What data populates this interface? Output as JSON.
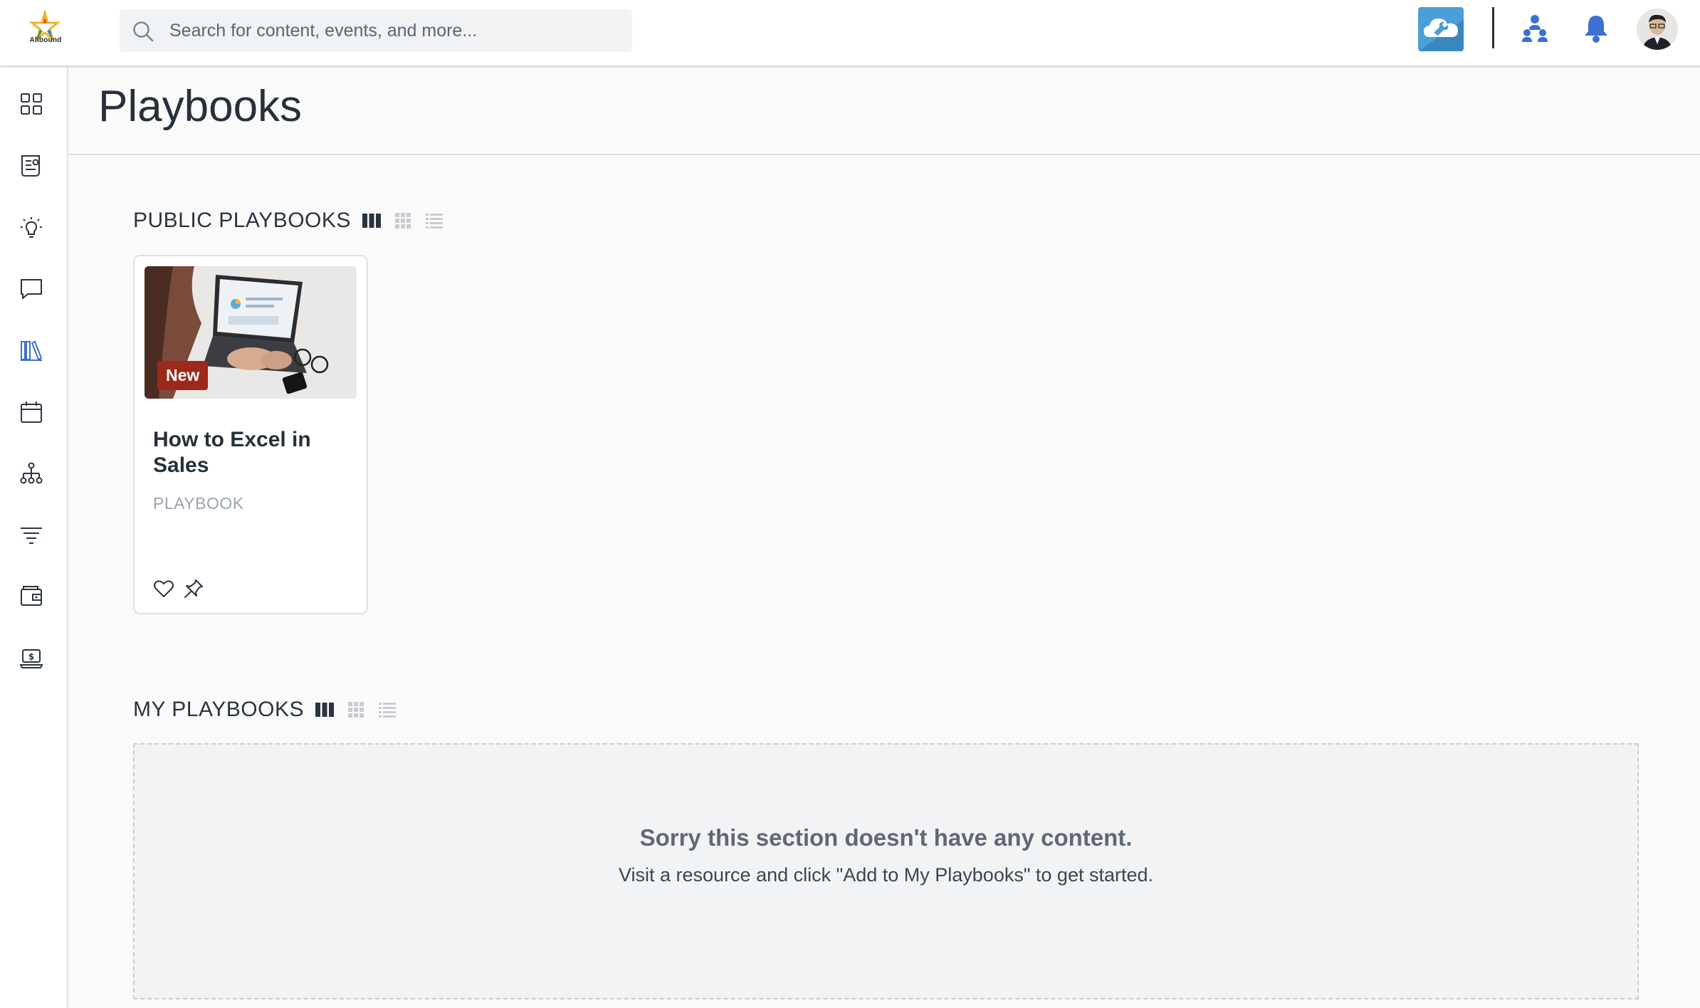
{
  "brand": {
    "name": "Allbound"
  },
  "search": {
    "placeholder": "Search for content, events, and more..."
  },
  "header": {
    "title": "Playbooks"
  },
  "sidebar": {
    "items": [
      {
        "name": "dashboard-icon",
        "active": false
      },
      {
        "name": "news-icon",
        "active": false
      },
      {
        "name": "lightbulb-icon",
        "active": false
      },
      {
        "name": "chat-icon",
        "active": false
      },
      {
        "name": "library-icon",
        "active": true
      },
      {
        "name": "calendar-icon",
        "active": false
      },
      {
        "name": "org-chart-icon",
        "active": false
      },
      {
        "name": "filter-icon",
        "active": false
      },
      {
        "name": "wallet-icon",
        "active": false
      },
      {
        "name": "laptop-dollar-icon",
        "active": false
      }
    ]
  },
  "sections": {
    "public": {
      "title": "PUBLIC PLAYBOOKS",
      "cards": [
        {
          "badge": "New",
          "title": "How to Excel in Sales",
          "type": "PLAYBOOK"
        }
      ]
    },
    "mine": {
      "title": "MY PLAYBOOKS",
      "empty_title": "Sorry this section doesn't have any content.",
      "empty_message": "Visit a resource and click \"Add to My Playbooks\" to get started."
    }
  },
  "colors": {
    "accent": "#3b6fd1",
    "badge": "#9b2a1c",
    "cloud": "#4a9fd6"
  }
}
